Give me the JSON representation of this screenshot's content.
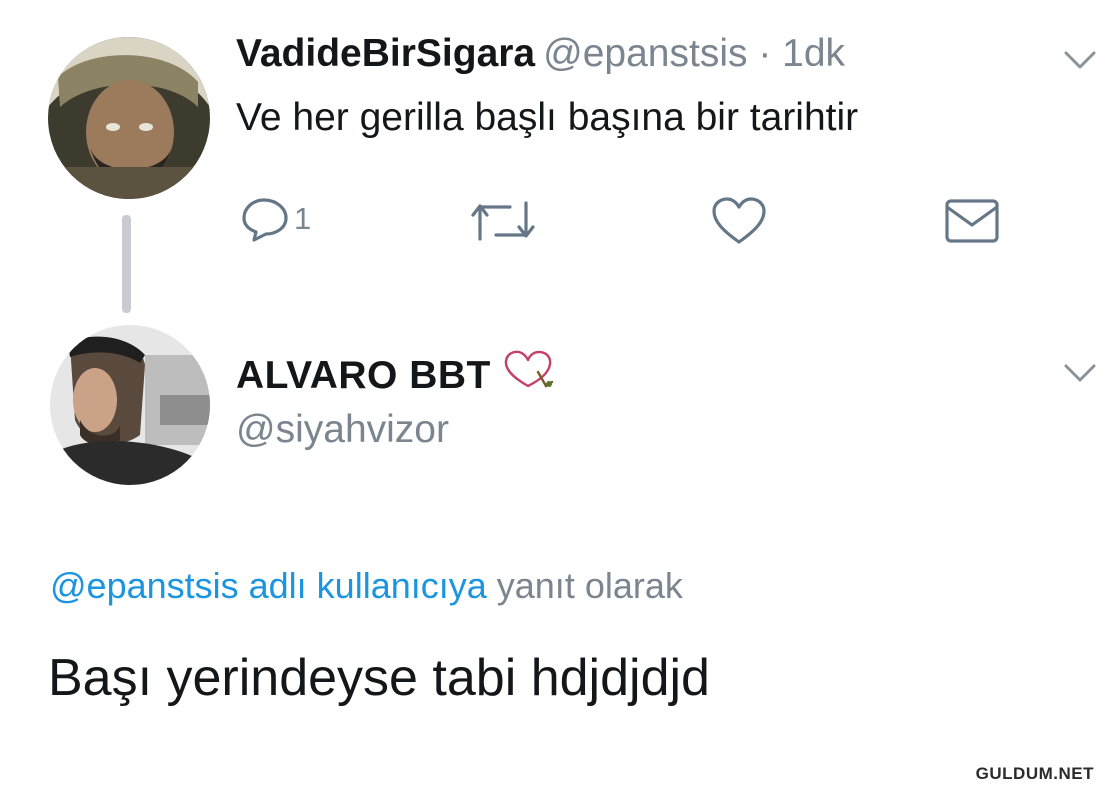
{
  "tweet": {
    "author_name": "VadideBirSigara",
    "author_handle": "@epanstsis",
    "time": "· 1dk",
    "text": "Ve her gerilla başlı başına bir tarihtir",
    "reply_count": "1"
  },
  "reply": {
    "author_name": "ALVARO BBT",
    "author_handle": "@siyahvizor",
    "replying_to_mention": "@epanstsis adlı kullanıcıya",
    "replying_to_suffix": " yanıt olarak",
    "text": "Başı yerindeyse tabi hdjdjdjd"
  },
  "icons": {
    "reply": "reply-icon",
    "retweet": "retweet-icon",
    "like": "heart-icon",
    "share": "mail-icon",
    "more": "chevron-down-icon",
    "name_badge": "heart-outline-icon"
  },
  "colors": {
    "link": "#1b95e0",
    "secondary_text": "#7a858f",
    "primary_text": "#14171a",
    "icon_gray": "#657786"
  },
  "watermark": "GULDUM.NET"
}
